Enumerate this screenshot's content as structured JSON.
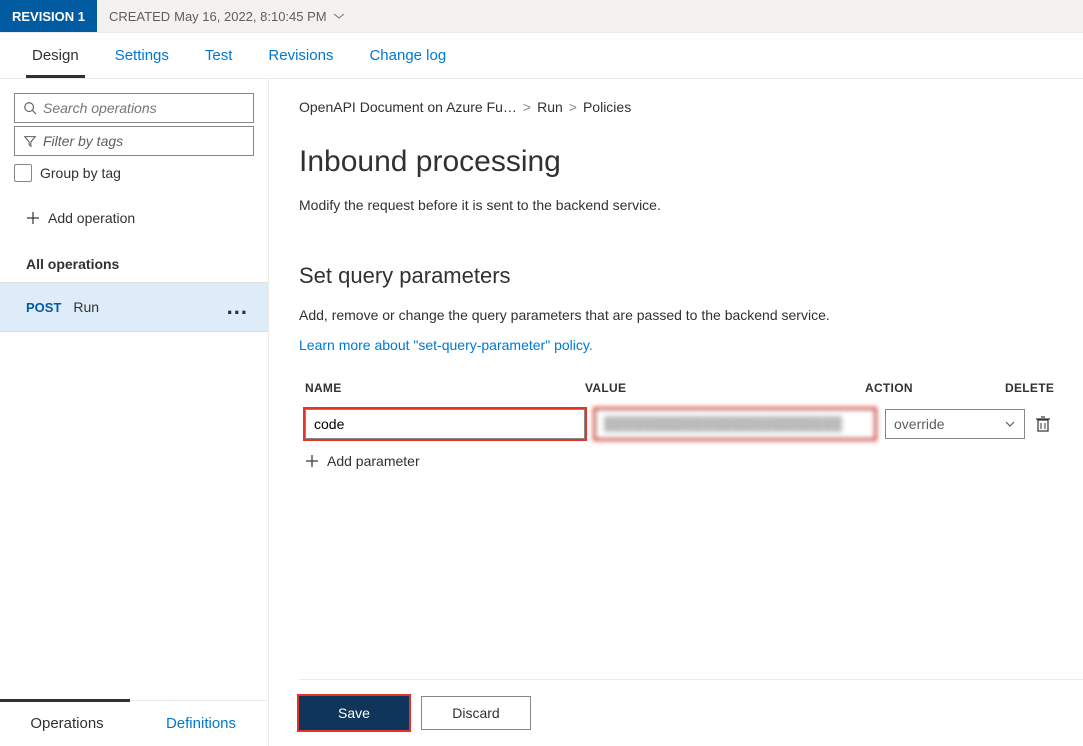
{
  "revision": {
    "badge": "REVISION 1",
    "created_label": "CREATED",
    "created_value": "May 16, 2022, 8:10:45 PM"
  },
  "tabs": {
    "design": "Design",
    "settings": "Settings",
    "test": "Test",
    "revisions": "Revisions",
    "changelog": "Change log"
  },
  "sidebar": {
    "search_placeholder": "Search operations",
    "filter_placeholder": "Filter by tags",
    "group_label": "Group by tag",
    "add_operation": "Add operation",
    "all_operations": "All operations",
    "op_method": "POST",
    "op_name": "Run",
    "bottom_tabs": {
      "operations": "Operations",
      "definitions": "Definitions"
    }
  },
  "breadcrumbs": {
    "api": "OpenAPI Document on Azure Fu…",
    "op": "Run",
    "section": "Policies"
  },
  "page": {
    "title": "Inbound processing",
    "description": "Modify the request before it is sent to the backend service."
  },
  "query_section": {
    "heading": "Set query parameters",
    "description": "Add, remove or change the query parameters that are passed to the backend service.",
    "learn_more": "Learn more about \"set-query-parameter\" policy.",
    "columns": {
      "name": "NAME",
      "value": "VALUE",
      "action": "ACTION",
      "delete": "DELETE"
    },
    "row": {
      "name": "code",
      "value": "████████████████████████",
      "action": "override"
    },
    "add_label": "Add parameter"
  },
  "buttons": {
    "save": "Save",
    "discard": "Discard"
  }
}
